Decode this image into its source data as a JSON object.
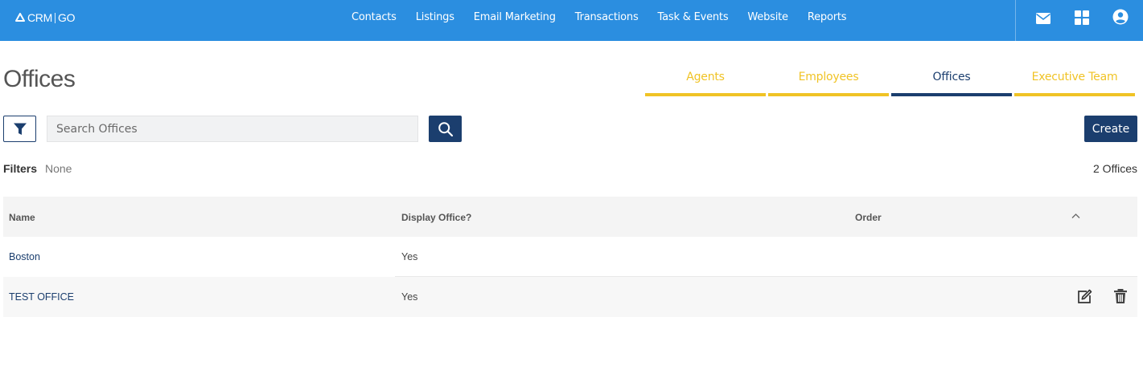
{
  "brand": {
    "part1": "CRM",
    "part2": "GO"
  },
  "nav": [
    "Contacts",
    "Listings",
    "Email Marketing",
    "Transactions",
    "Task & Events",
    "Website",
    "Reports"
  ],
  "icons": {
    "mail": "mail-icon",
    "apps": "apps-grid-icon",
    "account": "account-icon"
  },
  "page": {
    "title": "Offices"
  },
  "tabs": [
    "Agents",
    "Employees",
    "Offices",
    "Executive Team"
  ],
  "active_tab": "Offices",
  "search": {
    "placeholder": "Search Offices",
    "value": ""
  },
  "create_label": "Create",
  "filters": {
    "label": "Filters",
    "value": "None"
  },
  "count_label": "2 Offices",
  "table": {
    "columns": [
      "Name",
      "Display Office?",
      "Order"
    ],
    "rows": [
      {
        "name": "Boston",
        "display": "Yes",
        "order": ""
      },
      {
        "name": "TEST OFFICE",
        "display": "Yes",
        "order": ""
      }
    ]
  },
  "colors": {
    "header": "#2b8ee0",
    "primary": "#1b3e6e",
    "accent": "#f0c325"
  }
}
